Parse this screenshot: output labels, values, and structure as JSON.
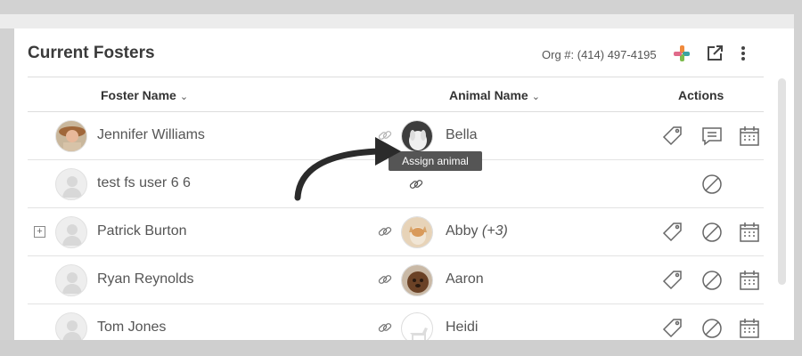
{
  "header": {
    "title": "Current Fosters",
    "org_text": "Org #: (414) 497-4195"
  },
  "columns": {
    "foster": "Foster Name",
    "animal": "Animal Name",
    "actions": "Actions",
    "sort_glyph": "⌄"
  },
  "rows": [
    {
      "foster": "Jennifer Williams",
      "animal": "Bella",
      "extra": "",
      "expandable": false,
      "actions": [
        "tag-icon",
        "message-icon",
        "calendar-icon"
      ]
    },
    {
      "foster": "test fs user 6 6",
      "animal": "",
      "extra": "",
      "expandable": false,
      "actions": [
        "block-icon"
      ]
    },
    {
      "foster": "Patrick Burton",
      "animal": "Abby",
      "extra": "(+3)",
      "expandable": true,
      "actions": [
        "tag-icon",
        "block-icon",
        "calendar-icon"
      ]
    },
    {
      "foster": "Ryan Reynolds",
      "animal": "Aaron",
      "extra": "",
      "expandable": false,
      "actions": [
        "tag-icon",
        "block-icon",
        "calendar-icon"
      ]
    },
    {
      "foster": "Tom Jones",
      "animal": "Heidi",
      "extra": "",
      "expandable": false,
      "actions": [
        "tag-icon",
        "block-icon",
        "calendar-icon"
      ]
    }
  ],
  "tooltip": "Assign animal",
  "expand_glyph": "+",
  "colors": {
    "plus_orange": "#f08a3c",
    "plus_teal": "#3aa3a3",
    "plus_green": "#7dbb4c",
    "plus_pink": "#e06a8a",
    "icon_gray": "#666666"
  }
}
